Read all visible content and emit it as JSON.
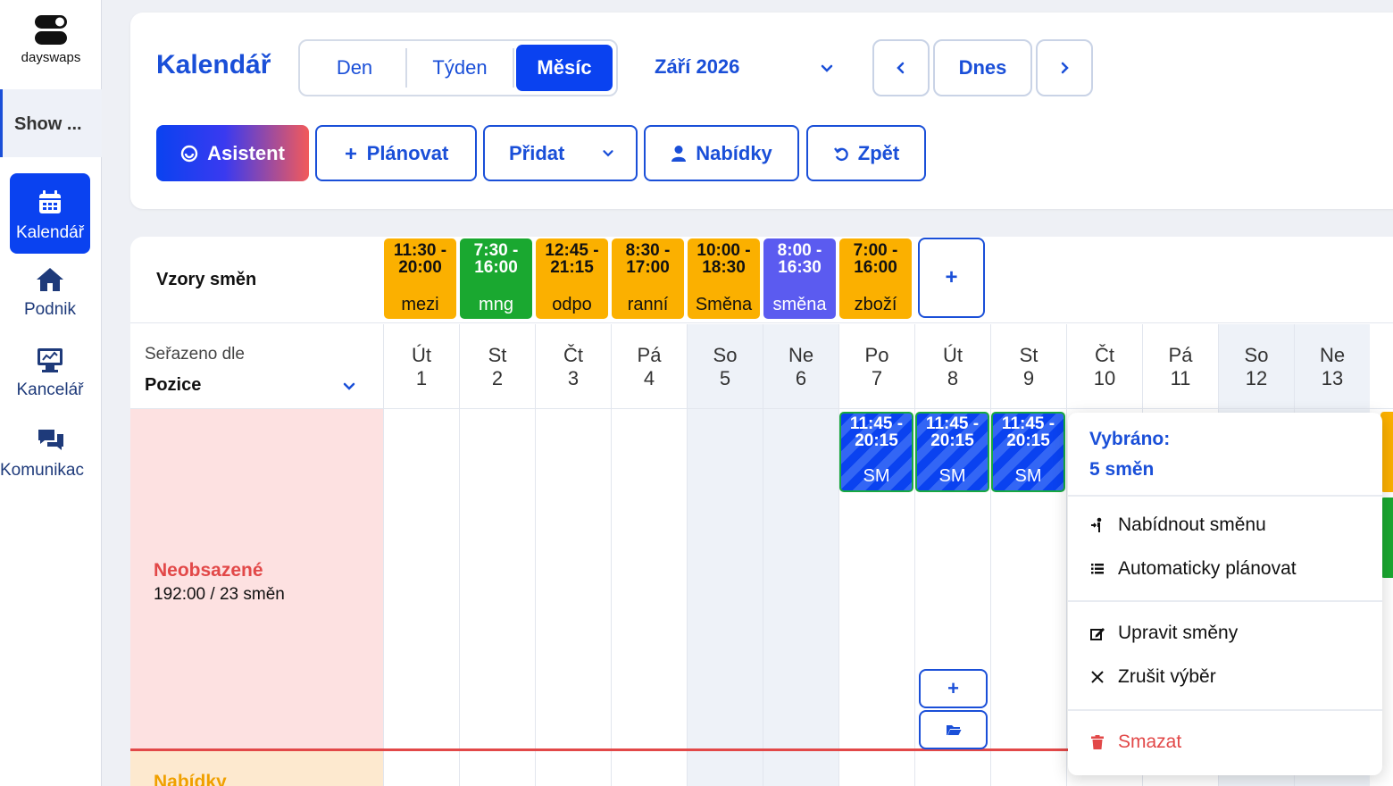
{
  "sidebar": {
    "logo_text": "dayswaps",
    "workspace": "Show ...",
    "items": [
      {
        "label": "Kalendář",
        "icon": "calendar-icon",
        "active": true
      },
      {
        "label": "Podnik",
        "icon": "home-icon"
      },
      {
        "label": "Kancelář",
        "icon": "monitor-icon"
      },
      {
        "label": "Komunikac",
        "icon": "chat-icon"
      }
    ]
  },
  "header": {
    "title": "Kalendář",
    "views": [
      "Den",
      "Týden",
      "Měsíc"
    ],
    "active_view": "Měsíc",
    "month": "Září 2026",
    "today": "Dnes",
    "actions": {
      "assistant": "Asistent",
      "plan": "Plánovat",
      "add": "Přidat",
      "offers": "Nabídky",
      "back": "Zpět"
    }
  },
  "templates": {
    "label": "Vzory směn",
    "items": [
      {
        "time1": "11:30 -",
        "time2": "20:00",
        "name": "mezi",
        "color": "#fbb000"
      },
      {
        "time1": "7:30 -",
        "time2": "16:00",
        "name": "mng",
        "color": "#1aa830"
      },
      {
        "time1": "12:45 -",
        "time2": "21:15",
        "name": "odpo",
        "color": "#fbb000"
      },
      {
        "time1": "8:30 -",
        "time2": "17:00",
        "name": "ranní",
        "color": "#fbb000"
      },
      {
        "time1": "10:00 -",
        "time2": "18:30",
        "name": "Směna",
        "color": "#fbb000"
      },
      {
        "time1": "8:00 -",
        "time2": "16:30",
        "name": "směna",
        "color": "#5b5bf0"
      },
      {
        "time1": "7:00 -",
        "time2": "16:00",
        "name": "zboží",
        "color": "#fbb000"
      }
    ],
    "add": "+"
  },
  "grid": {
    "sort_label": "Seřazeno dle",
    "sort_value": "Pozice",
    "days": [
      {
        "dow": "Út",
        "num": "1",
        "weekend": false
      },
      {
        "dow": "St",
        "num": "2",
        "weekend": false
      },
      {
        "dow": "Čt",
        "num": "3",
        "weekend": false
      },
      {
        "dow": "Pá",
        "num": "4",
        "weekend": false
      },
      {
        "dow": "So",
        "num": "5",
        "weekend": true
      },
      {
        "dow": "Ne",
        "num": "6",
        "weekend": true
      },
      {
        "dow": "Po",
        "num": "7",
        "weekend": false
      },
      {
        "dow": "Út",
        "num": "8",
        "weekend": false
      },
      {
        "dow": "St",
        "num": "9",
        "weekend": false
      },
      {
        "dow": "Čt",
        "num": "10",
        "weekend": false
      },
      {
        "dow": "Pá",
        "num": "11",
        "weekend": false
      },
      {
        "dow": "So",
        "num": "12",
        "weekend": true
      },
      {
        "dow": "Ne",
        "num": "13",
        "weekend": true
      }
    ],
    "unassigned_title": "Neobsazené",
    "unassigned_stats": "192:00 / 23 směn",
    "offers_title": "Nabídky",
    "shifts": [
      {
        "time1": "11:45 -",
        "time2": "20:15",
        "name": "SM"
      },
      {
        "time1": "11:45 -",
        "time2": "20:15",
        "name": "SM"
      },
      {
        "time1": "11:45 -",
        "time2": "20:15",
        "name": "SM"
      }
    ],
    "cell_add": "+"
  },
  "context_menu": {
    "title1": "Vybráno:",
    "title2": "5 směn",
    "items": [
      {
        "label": "Nabídnout směnu",
        "icon": "offer-shift-icon"
      },
      {
        "label": "Automaticky plánovat",
        "icon": "list-icon"
      },
      {
        "label": "Upravit směny",
        "icon": "edit-icon"
      },
      {
        "label": "Zrušit výběr",
        "icon": "close-icon"
      },
      {
        "label": "Smazat",
        "icon": "trash-icon"
      }
    ]
  },
  "colors": {
    "accent": "#0a42f0",
    "danger": "#e24848",
    "unassigned_bg": "#fde1e1",
    "offers_bg": "#fde9cf",
    "weekend_bg": "#eef2f8"
  }
}
